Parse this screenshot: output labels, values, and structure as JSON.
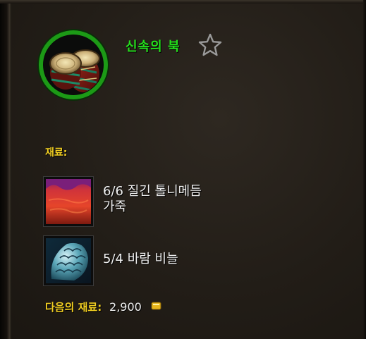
{
  "recipe": {
    "name": "신속의 북",
    "icon": "drums-icon",
    "favorite_icon": "star-outline-icon"
  },
  "reagents_header": "재료:",
  "reagents": [
    {
      "have": 6,
      "need": 6,
      "count_text": "6/6",
      "name_line1": "질긴 톨니메듬",
      "name_line2": "가죽",
      "icon": "leather-icon"
    },
    {
      "have": 5,
      "need": 4,
      "count_text": "5/4",
      "name_line1": "바람 비늘",
      "name_line2": "",
      "icon": "scale-icon"
    }
  ],
  "optional": {
    "label": "다음의 재료:",
    "value": "2,900",
    "icon": "gold-coin-icon"
  },
  "colors": {
    "recipe_name": "#25e01d",
    "header": "#f2cf22",
    "text": "#f1f1f1",
    "icon_ring": "#1c9a16"
  }
}
